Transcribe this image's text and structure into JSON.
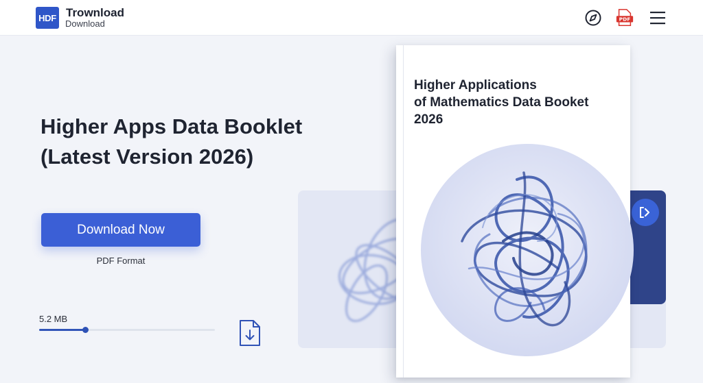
{
  "header": {
    "logo_text": "HDF",
    "brand_title": "Trownload",
    "brand_subtitle": "Download",
    "icons": [
      "compass-icon",
      "pdf-icon",
      "menu-icon"
    ],
    "pdf_icon_text": "PDF"
  },
  "hero": {
    "title_line1": "Higher Apps Data Booklet",
    "title_line2": "(Latest Version 2026)",
    "download_button": "Download Now",
    "format": "PDF Format",
    "file_size": "5.2 MB",
    "progress_fraction": 0.26
  },
  "book": {
    "title_line1": "Higher Applications",
    "title_line2": "of Mathematics Data Booket",
    "title_line3": "2026"
  },
  "colors": {
    "accent": "#3b5fd6",
    "brand": "#2f56c8",
    "side_tab": "#2f4489",
    "background": "#f2f4f9"
  }
}
